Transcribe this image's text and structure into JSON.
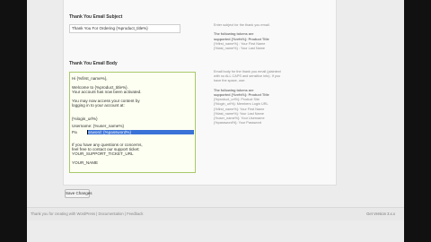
{
  "subject_section": {
    "title": "Thank You Email Subject",
    "value": "Thank You For Ordering {%product_title%}",
    "help": [
      "Enter subject for the thank you email.",
      "",
      "The following tokens are",
      "supported {%refs%}: Product Title",
      "{%first_name%} : Your First Name",
      "{%last_name%} : Your Last Name"
    ]
  },
  "body_section": {
    "title": "Thank You Email Body",
    "lines": [
      "Hi {%first_name%},",
      "",
      "Welcome to {%product_title%}.",
      "Your account has now been activated.",
      "",
      "You may now access your content by",
      "logging in to your account at:",
      "",
      "{%login_url%}",
      "Username: {%user_name%}",
      "Pa",
      "",
      "If you have any questions or concerns,",
      "feel free to contact our support ticket:",
      "YOUR_SUPPORT_TICKET_URL",
      "",
      "YOUR_NAME"
    ],
    "selected_text": "ssword: {%password%}",
    "help": [
      "Email body for the thank you email (plaintext",
      "with no ALL CAPS and sensitive info). If you",
      "have the space, use:",
      "",
      "The following tokens are",
      "supported {%refs%}: Product Title",
      "{%product_url%}: Product Site",
      "{%login_url%}: Members Login URL",
      "{%first_name%}: Your First Name",
      "{%last_name%}: Your Last Name",
      "{%user_name%}: Your Username",
      "{%password%}: Your Password"
    ]
  },
  "actions": {
    "save_label": "Save Changes"
  },
  "footer": {
    "left": "Thank you for creating with WordPress | Documentation | Feedback",
    "right": "Get Version 3.x.x"
  }
}
